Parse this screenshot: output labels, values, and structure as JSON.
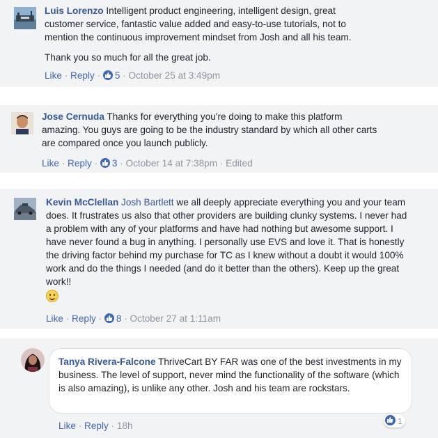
{
  "comments": [
    {
      "author": "Luis Lorenzo",
      "mention": "",
      "text": " Intelligent product engineering, intelligent design, great customer service, fantastic value added and easy-to-use tutorials, not to mention the continuous improvement mindset from Josh and all his team.",
      "text2": "Thank you so much for all the great job.",
      "like_label": "Like",
      "reply_label": "Reply",
      "reaction_count": "5",
      "timestamp": "October 25 at 3:49pm",
      "edited": ""
    },
    {
      "author": "Jose Cernuda",
      "mention": "",
      "text": " Thanks for everything you're doing to make this platform amazing. You guys are going to be the industry standard by which all other carts are compared once you launch publicly.",
      "like_label": "Like",
      "reply_label": "Reply",
      "reaction_count": "3",
      "timestamp": "October 14 at 7:38pm",
      "edited": "Edited"
    },
    {
      "author": "Kevin McClellan",
      "mention": "Josh Bartlett",
      "text": " we all deeply appreciate everything you and your team does. It frustrates us also that other providers are building clunky systems. I never had a problem with any of your platforms and have had nothing but awesome support. I have never found a bug in anything. I personally use EVS and love it. That is honestly the driving factor behind my purchase for TC as I knew without a doubt it would 100% work and do the things I needed (and do it better than the others). Keep up the great work!!",
      "like_label": "Like",
      "reply_label": "Reply",
      "reaction_count": "8",
      "timestamp": "October 27 at 1:11am",
      "edited": ""
    },
    {
      "author": "Tanya Rivera-Falcone",
      "mention": "",
      "text": " ThriveCart BY FAR was one of the best investments in my business. The level of support, never mind the functionality of the software (which is also amazing), is unlike any other. Josh and his team are rockstars.",
      "like_label": "Like",
      "reply_label": "Reply",
      "timestamp": "18h",
      "reaction_count": "1"
    }
  ],
  "colors": {
    "author": "#365899",
    "link": "#4267b2",
    "meta": "#90949c",
    "band": "#f2f3f5"
  },
  "icons": {
    "reaction": "thumbs-up-icon",
    "emoji": "smile-emoji-icon"
  }
}
